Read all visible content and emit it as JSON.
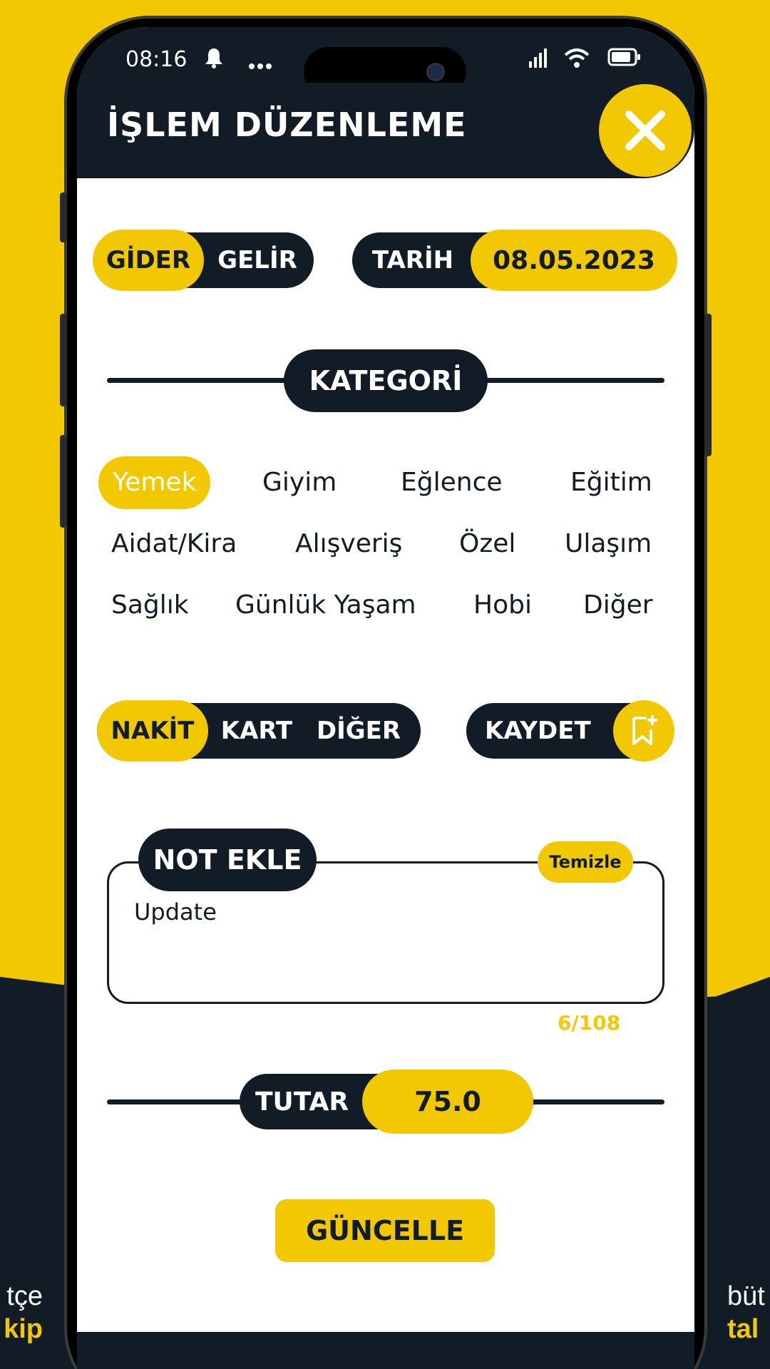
{
  "promo": {
    "left_line1": "tçe",
    "left_line2": "kip",
    "right_line1": "büt",
    "right_line2": "tal"
  },
  "status_bar": {
    "time": "08:16",
    "icons": [
      "bell-icon",
      "more-icon",
      "signal-icon",
      "wifi-icon",
      "battery-icon"
    ]
  },
  "header": {
    "title": "İŞLEM DÜZENLEME",
    "close_icon": "close-icon"
  },
  "type_toggle": {
    "options": [
      "GİDER",
      "GELİR"
    ],
    "selected": "GİDER"
  },
  "date": {
    "label": "TARİH",
    "value": "08.05.2023"
  },
  "category": {
    "title": "KATEGORİ",
    "items": [
      "Yemek",
      "Giyim",
      "Eğlence",
      "Eğitim",
      "Aidat/Kira",
      "Alışveriş",
      "Özel",
      "Ulaşım",
      "Sağlık",
      "Günlük Yaşam",
      "Hobi",
      "Diğer"
    ],
    "selected": "Yemek"
  },
  "payment": {
    "options": [
      "NAKİT",
      "KART",
      "DİĞER"
    ],
    "selected": "NAKİT"
  },
  "save": {
    "label": "KAYDET",
    "icon": "bookmark-add-icon"
  },
  "note": {
    "title": "NOT EKLE",
    "clear_label": "Temizle",
    "value": "Update",
    "counter": "6/108"
  },
  "amount": {
    "label": "TUTAR",
    "value": "75.0"
  },
  "update_button": {
    "label": "GÜNCELLE"
  },
  "colors": {
    "accent": "#F2C803",
    "dark": "#111C27",
    "background": "#FFFFFF"
  }
}
